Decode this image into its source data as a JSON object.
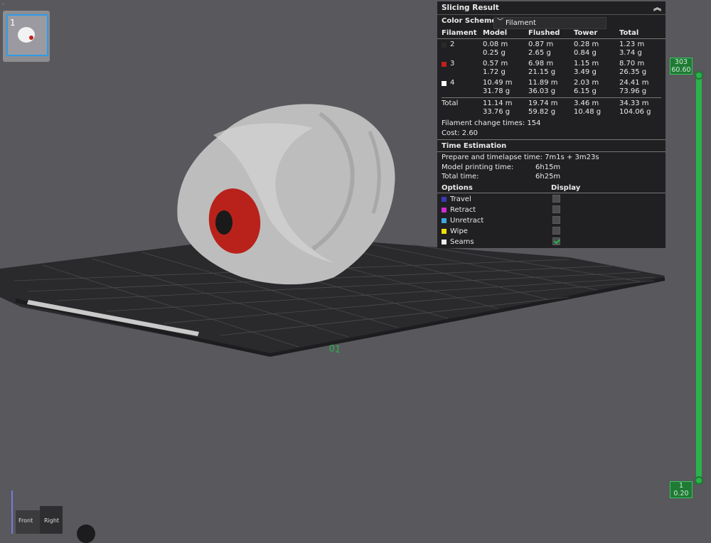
{
  "plate_thumbnail": {
    "number": "1"
  },
  "panel": {
    "title": "Slicing Result",
    "color_scheme_label": "Color Scheme",
    "color_scheme_value": "Filament",
    "table_headers": [
      "Filament",
      "Model",
      "Flushed",
      "Tower",
      "Total"
    ],
    "rows": [
      {
        "id": "2",
        "color": "#2a2a2a",
        "model": [
          "0.08 m",
          "0.25 g"
        ],
        "flushed": [
          "0.87 m",
          "2.65 g"
        ],
        "tower": [
          "0.28 m",
          "0.84 g"
        ],
        "total": [
          "1.23 m",
          "3.74 g"
        ]
      },
      {
        "id": "3",
        "color": "#c0201a",
        "model": [
          "0.57 m",
          "1.72 g"
        ],
        "flushed": [
          "6.98 m",
          "21.15 g"
        ],
        "tower": [
          "1.15 m",
          "3.49 g"
        ],
        "total": [
          "8.70 m",
          "26.35 g"
        ]
      },
      {
        "id": "4",
        "color": "#ffffff",
        "model": [
          "10.49 m",
          "31.78 g"
        ],
        "flushed": [
          "11.89 m",
          "36.03 g"
        ],
        "tower": [
          "2.03 m",
          "6.15 g"
        ],
        "total": [
          "24.41 m",
          "73.96 g"
        ]
      }
    ],
    "total_row": {
      "label": "Total",
      "model": [
        "11.14 m",
        "33.76 g"
      ],
      "flushed": [
        "19.74 m",
        "59.82 g"
      ],
      "tower": [
        "3.46 m",
        "10.48 g"
      ],
      "total": [
        "34.33 m",
        "104.06 g"
      ]
    },
    "filament_change": "Filament change times:  154",
    "cost": "Cost:  2.60",
    "time_title": "Time Estimation",
    "prepare_time": "Prepare and timelapse time: 7m1s + 3m23s",
    "model_time_label": "Model printing time:",
    "model_time_value": "6h15m",
    "total_time_label": "Total time:",
    "total_time_value": "6h25m",
    "options_label": "Options",
    "display_label": "Display",
    "options": [
      {
        "label": "Travel",
        "color": "#3a3ab5",
        "checked": false
      },
      {
        "label": "Retract",
        "color": "#d02bd0",
        "checked": false
      },
      {
        "label": "Unretract",
        "color": "#3aa8e0",
        "checked": false
      },
      {
        "label": "Wipe",
        "color": "#f0e000",
        "checked": false
      },
      {
        "label": "Seams",
        "color": "#eeeeee",
        "checked": true
      }
    ]
  },
  "layer_slider": {
    "top_layer": "303",
    "top_height": "60.60",
    "bottom_layer": "1",
    "bottom_height": "0.20"
  },
  "view_cube": {
    "front": "Front",
    "right": "Right"
  },
  "plate_mark": "01"
}
